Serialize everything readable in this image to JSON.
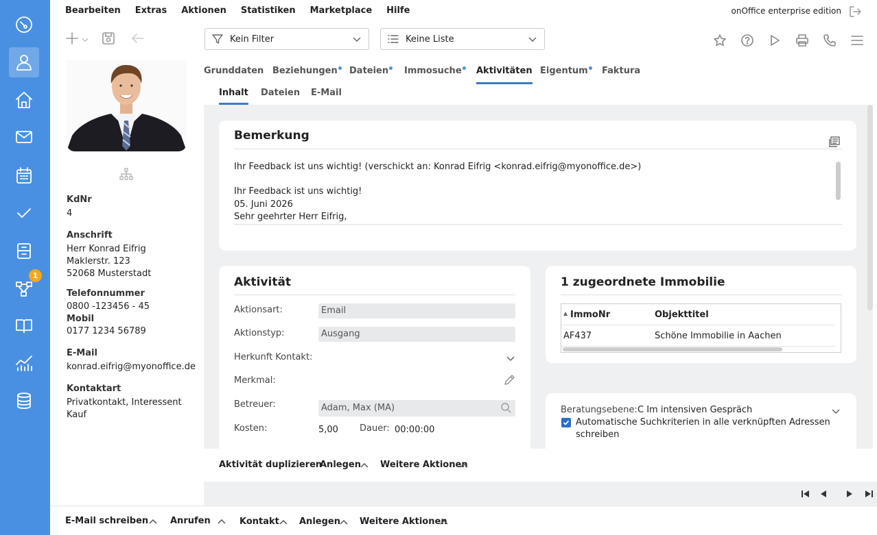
{
  "menu": {
    "items": [
      "Bearbeiten",
      "Extras",
      "Aktionen",
      "Statistiken",
      "Marketplace",
      "Hilfe"
    ],
    "edition": "onOffice enterprise edition"
  },
  "toolbar": {
    "filter_label": "Kein Filter",
    "list_label": "Keine Liste"
  },
  "nav": {
    "badge_count": "1"
  },
  "profile": {
    "kdnr_label": "KdNr",
    "kdnr": "4",
    "address_label": "Anschrift",
    "address_line1": "Herr Konrad Eifrig",
    "address_line2": "Maklerstr. 123",
    "address_line3": "52068 Musterstadt",
    "phone_label": "Telefonnummer",
    "phone": "0800 -123456 - 45",
    "mobile_label": "Mobil",
    "mobile": "0177 1234 56789",
    "email_label": "E-Mail",
    "email": "konrad.eifrig@myonoffice.de",
    "contact_type_label": "Kontaktart",
    "contact_type_line1": "Privatkontakt, Interessent",
    "contact_type_line2": "Kauf"
  },
  "tabs": [
    {
      "label": "Grunddaten"
    },
    {
      "label": "Beziehungen"
    },
    {
      "label": "Dateien"
    },
    {
      "label": "Immosuche"
    },
    {
      "label": "Aktivitäten"
    },
    {
      "label": "Eigentum"
    },
    {
      "label": "Faktura"
    }
  ],
  "subtabs": [
    {
      "label": "Inhalt"
    },
    {
      "label": "Dateien"
    },
    {
      "label": "E-Mail"
    }
  ],
  "remark": {
    "title": "Bemerkung",
    "line1": "Ihr Feedback ist uns wichtig! (verschickt an: Konrad Eifrig <konrad.eifrig@myonoffice.de>)",
    "line2": "Ihr Feedback ist uns wichtig!",
    "line3": "05. Juni 2026",
    "line4": "Sehr geehrter Herr Eifrig,"
  },
  "activity": {
    "title": "Aktivität",
    "aktionsart_label": "Aktionsart:",
    "aktionsart": "Email",
    "aktionstyp_label": "Aktionstyp:",
    "aktionstyp": "Ausgang",
    "herkunft_label": "Herkunft Kontakt:",
    "merkmal_label": "Merkmal:",
    "betreuer_label": "Betreuer:",
    "betreuer": "Adam, Max (MA)",
    "kosten_label": "Kosten:",
    "kosten": "5,00",
    "dauer_label": "Dauer:",
    "dauer": "00:00:00"
  },
  "properties": {
    "title": "1 zugeordnete Immobilie",
    "col1": "ImmoNr",
    "col2": "Objekttitel",
    "rows": [
      {
        "nr": "AF437",
        "title": "Schöne Immobilie in Aachen"
      }
    ]
  },
  "advice": {
    "label": "Beratungsebene:",
    "value": "C Im intensiven Gespräch",
    "checkbox_line1": "Automatische Suchkriterien in alle verknüpften Adressen",
    "checkbox_line2": "schreiben"
  },
  "actionbar": {
    "duplicate": "Aktivität duplizieren",
    "create": "Anlegen",
    "more": "Weitere Aktionen"
  },
  "bottombar": {
    "email": "E-Mail schreiben",
    "call": "Anrufen",
    "contact": "Kontakt",
    "create": "Anlegen",
    "more": "Weitere Aktionen"
  }
}
